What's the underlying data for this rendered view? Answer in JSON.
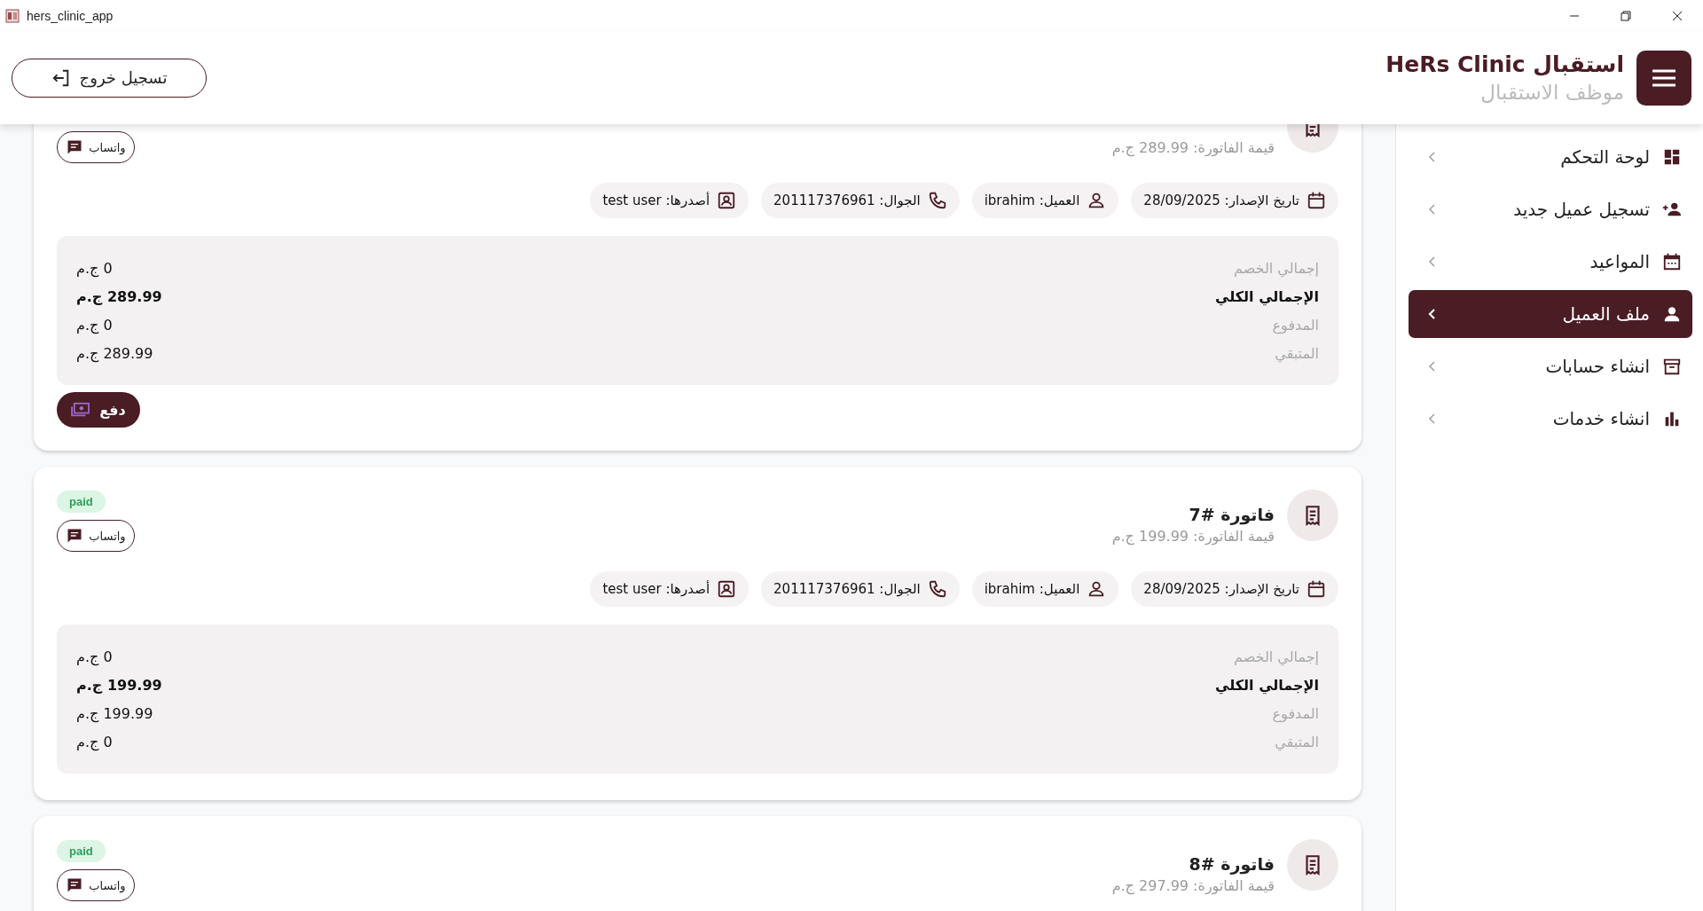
{
  "window": {
    "title": "hers_clinic_app"
  },
  "header": {
    "title": "استقبال HeRs Clinic",
    "subtitle": "موظف الاستقبال",
    "logout_button": "تسجيل خروج"
  },
  "sidebar": {
    "items": [
      {
        "label": "لوحة التحكم",
        "selected": false
      },
      {
        "label": "تسجيل عميل جديد",
        "selected": false
      },
      {
        "label": "المواعيد",
        "selected": false
      },
      {
        "label": "ملف العميل",
        "selected": true
      },
      {
        "label": "انشاء حسابات",
        "selected": false
      },
      {
        "label": "انشاء خدمات",
        "selected": false
      }
    ]
  },
  "invoices": [
    {
      "amount_line": "قيمة الفاتورة: 289.99 ج.م",
      "whatsapp_button": "واتساب",
      "chips": [
        {
          "kind": "date",
          "text": "تاريخ الإصدار: 28/09/2025"
        },
        {
          "kind": "customer",
          "text": "العميل: ibrahim"
        },
        {
          "kind": "phone",
          "text": "الجوال: 201117376961"
        },
        {
          "kind": "issuer",
          "text": "أصدرها: test user"
        }
      ],
      "summary": [
        {
          "label": "إجمالي الخصم",
          "value": "0 ج.م",
          "emphasized": false
        },
        {
          "label": "الإجمالي الكلي",
          "value": "289.99 ج.م",
          "emphasized": true
        },
        {
          "label": "المدفوع",
          "value": "0 ج.م",
          "emphasized": false
        },
        {
          "label": "المتبقي",
          "value": "289.99 ج.م",
          "emphasized": false
        }
      ],
      "pay_button": "دفع"
    },
    {
      "title": "فاتورة #7",
      "amount_line": "قيمة الفاتورة: 199.99 ج.م",
      "status": "paid",
      "whatsapp_button": "واتساب",
      "chips": [
        {
          "kind": "date",
          "text": "تاريخ الإصدار: 28/09/2025"
        },
        {
          "kind": "customer",
          "text": "العميل: ibrahim"
        },
        {
          "kind": "phone",
          "text": "الجوال: 201117376961"
        },
        {
          "kind": "issuer",
          "text": "أصدرها: test user"
        }
      ],
      "summary": [
        {
          "label": "إجمالي الخصم",
          "value": "0 ج.م",
          "emphasized": false
        },
        {
          "label": "الإجمالي الكلي",
          "value": "199.99 ج.م",
          "emphasized": true
        },
        {
          "label": "المدفوع",
          "value": "199.99 ج.م",
          "emphasized": false
        },
        {
          "label": "المتبقي",
          "value": "0 ج.م",
          "emphasized": false
        }
      ]
    },
    {
      "title": "فاتورة #8",
      "amount_line": "قيمة الفاتورة: 297.99 ج.م",
      "status": "paid",
      "whatsapp_button": "واتساب"
    }
  ]
}
